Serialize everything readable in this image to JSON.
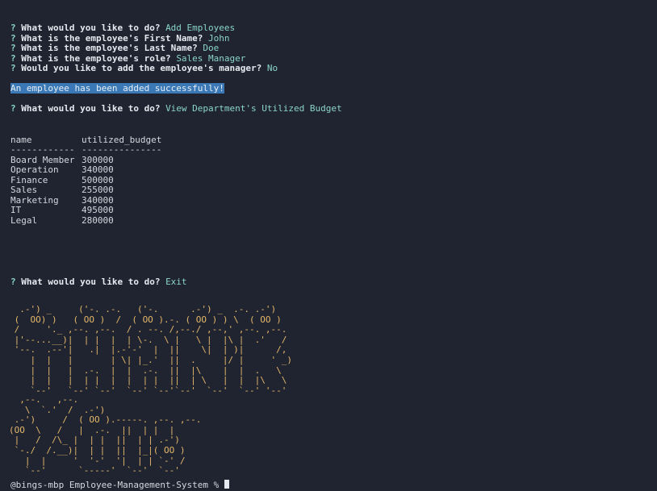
{
  "prompts": [
    {
      "marker": "?",
      "question": "What would you like to do?",
      "answer": "Add Employees"
    },
    {
      "marker": "?",
      "question": "What is the employee's First Name?",
      "answer": "John"
    },
    {
      "marker": "?",
      "question": "What is the employee's Last Name?",
      "answer": "Doe"
    },
    {
      "marker": "?",
      "question": "What is the employee's role?",
      "answer": "Sales Manager"
    },
    {
      "marker": "?",
      "question": "Would you like to add the employee's manager?",
      "answer": "No"
    }
  ],
  "success_message": "An employee has been added successfully!",
  "prompt2": {
    "marker": "?",
    "question": "What would you like to do?",
    "answer": "View Department's Utilized Budget"
  },
  "table": {
    "headers": [
      "name",
      "utilized_budget"
    ],
    "separators": [
      "------------",
      "---------------"
    ],
    "rows": [
      [
        "Board Member",
        "300000"
      ],
      [
        "Operation",
        "340000"
      ],
      [
        "Finance",
        "500000"
      ],
      [
        "Sales",
        "255000"
      ],
      [
        "Marketing",
        "340000"
      ],
      [
        "IT",
        "495000"
      ],
      [
        "Legal",
        "280000"
      ]
    ]
  },
  "prompt3": {
    "marker": "?",
    "question": "What would you like to do?",
    "answer": "Exit"
  },
  "ascii_art": {
    "thank": "  .-') _     ('-. .-.   ('-.      .-') _  .-. .-')  \n (  OO) )   ( OO )  /  ( OO ).-. ( OO ) ) \\  ( OO ) \n /     '._ ,--. ,--.  / . --. /,--./ ,--,' ,--. ,--. \n |'--...__)|  | |  |  | \\-.  \\ |   \\ |  |\\ |  .'   / \n '--.  .--'|   .|  |.-'-'  |  ||    \\|  | )|      /, \n    |  |   |       | \\| |_.'  ||  .     |/ |     ' _)\n    |  |   |  .-.  |  |  .-.  ||  |\\    |  |  .   \\  \n    |  |   |  | |  |  |  | |  ||  | \\   |  |  |\\   \\ \n    `--'   `--' `--'  `--' `--'`--'  `--'  `--' '--' ",
    "you": "  ,--.   ,--.                   \n   \\  `.'  /  .-')                \n .-')     /  ( OO ).-----. ,--. ,--.\n(OO  \\   /   |  .-.  ||  | |  |\n |   /  /\\_ |  | |  ||  | | .-')\n `-./  /.__)|  | |  ||  |_|( OO )\n   |  |     '  '-'  '|  | | `-' /\n   `--'      `-----'  `--'  `--'  "
  },
  "shell_prompt": "@bings-mbp Employee-Management-System % "
}
